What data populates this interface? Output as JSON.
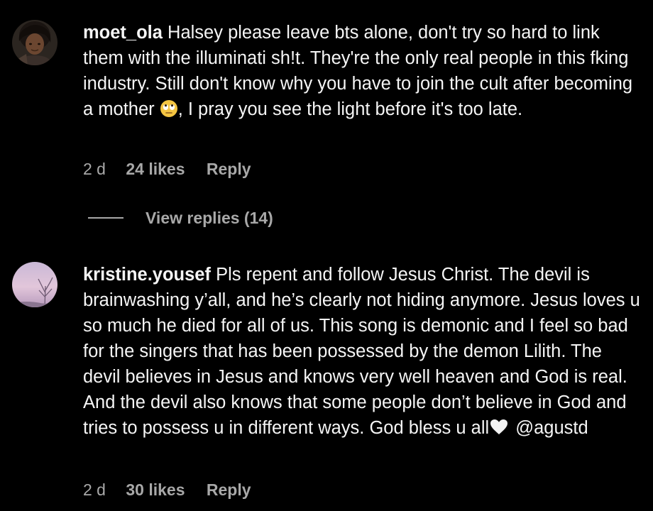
{
  "comments": [
    {
      "username": "moet_ola",
      "text_before_emoji": "Halsey please leave bts alone, don't try so hard to link them with the illuminati sh!t. They're the only real people in this fking industry. Still don't know why you have to join the cult after becoming a mother ",
      "emoji": "face-with-rolling-eyes",
      "text_after_emoji": ", I pray you see the light before it's too late.",
      "time": "2 d",
      "likes": "24 likes",
      "reply_label": "Reply"
    },
    {
      "username": "kristine.yousef",
      "text_before_emoji": "Pls repent and follow Jesus Christ. The devil is brainwashing y’all, and he’s clearly not hiding anymore. Jesus loves u so much he died for all of us. This song is demonic and I feel so bad for the singers that has been possessed by the demon Lilith. The devil believes in Jesus and knows very well heaven and God is real. And the devil also knows that some people don’t believe in God and tries to possess u in different ways. God bless u all",
      "emoji": "white-heart",
      "text_after_emoji": " @agustd",
      "time": "2 d",
      "likes": "30 likes",
      "reply_label": "Reply"
    }
  ],
  "view_replies_label": "View replies (14)",
  "colors": {
    "background": "#000000",
    "primary_text": "#f5f5f5",
    "secondary_text": "#a8a8a8"
  }
}
